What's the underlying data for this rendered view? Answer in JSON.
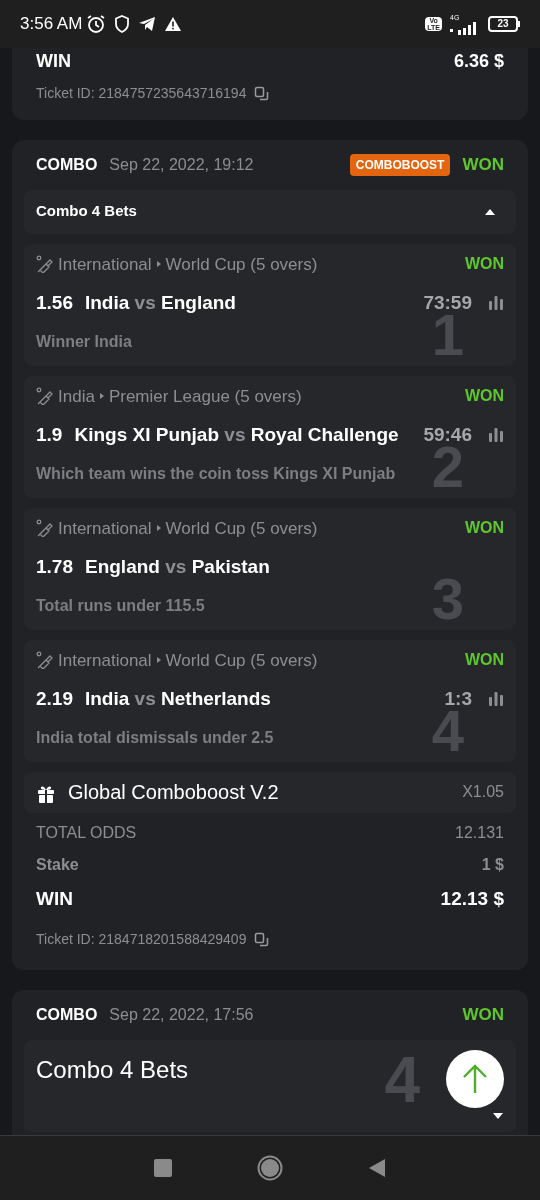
{
  "status_bar": {
    "time": "3:56 AM",
    "volte_top": "Vo",
    "volte_bottom": "LTE",
    "network": "4G",
    "battery": "23"
  },
  "tickets": [
    {
      "kind": "tail",
      "win_label": "WIN",
      "win_value": "6.36 $",
      "ticket_id": "Ticket ID: 2184757235643716194"
    },
    {
      "kind": "full",
      "type": "COMBO",
      "date": "Sep 22, 2022, 19:12",
      "badge": "COMBOBOOST",
      "status": "WON",
      "group": {
        "title": "Combo 4 Bets",
        "expanded": true
      },
      "legs": [
        {
          "index": "1",
          "country": "International",
          "league": "World Cup (5 overs)",
          "status": "WON",
          "odds": "1.56",
          "team1": "India",
          "vs": "vs",
          "team2": "England",
          "score": "73:59",
          "market": "Winner India"
        },
        {
          "index": "2",
          "country": "India",
          "league": "Premier League (5 overs)",
          "status": "WON",
          "odds": "1.9",
          "team1": "Kings XI Punjab",
          "vs": "vs",
          "team2": "Royal Challenge",
          "score": "59:46",
          "market": "Which team wins the coin toss Kings XI Punjab"
        },
        {
          "index": "3",
          "country": "International",
          "league": "World Cup (5 overs)",
          "status": "WON",
          "odds": "1.78",
          "team1": "England",
          "vs": "vs",
          "team2": "Pakistan",
          "market": "Total runs under 115.5"
        },
        {
          "index": "4",
          "country": "International",
          "league": "World Cup (5 overs)",
          "status": "WON",
          "odds": "2.19",
          "team1": "India",
          "vs": "vs",
          "team2": "Netherlands",
          "score": "1:3",
          "market": "India total dismissals under 2.5"
        }
      ],
      "boost": {
        "name": "Global Comboboost V.2",
        "value": "X1.05"
      },
      "totals": [
        {
          "kind": "odds",
          "label": "TOTAL ODDS",
          "value": "12.131"
        },
        {
          "kind": "stake",
          "label": "Stake",
          "value": "1 $"
        },
        {
          "kind": "win",
          "label": "WIN",
          "value": "12.13 $"
        }
      ],
      "ticket_id": "Ticket ID: 2184718201588429409"
    },
    {
      "kind": "head",
      "type": "COMBO",
      "date": "Sep 22, 2022, 17:56",
      "status": "WON",
      "group": {
        "title": "Combo 4 Bets",
        "expanded": false
      },
      "watermark": "4"
    }
  ]
}
